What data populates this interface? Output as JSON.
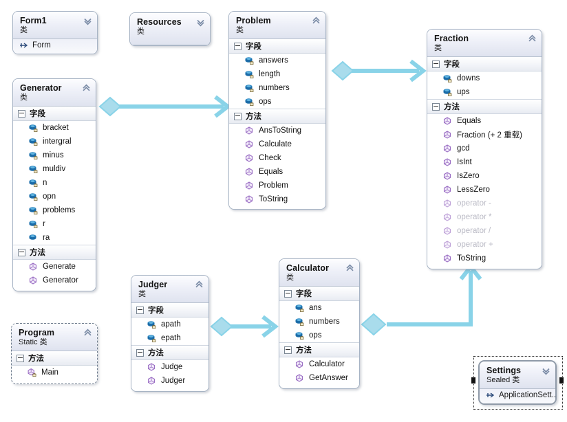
{
  "diagram": {
    "kind_class": "类",
    "kind_static_class": "Static 类",
    "kind_sealed_class": "Sealed 类",
    "compartment_fields": "字段",
    "compartment_methods": "方法",
    "colors": {
      "connector": "#89d3e8",
      "connector_fill": "#a9dcec",
      "class_border": "#a6b3c4",
      "header_gradient_top": "#fdfdff",
      "header_gradient_bottom": "#dfe3ef",
      "field_icon": "#1f6fa8",
      "method_icon": "#9b6fc4",
      "dimmed_text": "#b9b9c4"
    }
  },
  "classes": {
    "form1": {
      "name": "Form1",
      "kind": "类",
      "chevron": "chevron-down-icon",
      "base": "Form",
      "base_icon": "inherit-arrow-icon"
    },
    "resources": {
      "name": "Resources",
      "kind": "类",
      "chevron": "chevron-down-icon"
    },
    "problem": {
      "name": "Problem",
      "kind": "类",
      "chevron": "chevron-up-icon",
      "fields_header": "字段",
      "fields": [
        {
          "name": "answers",
          "icon": "field-private-icon",
          "dim": false
        },
        {
          "name": "length",
          "icon": "field-private-icon",
          "dim": false
        },
        {
          "name": "numbers",
          "icon": "field-private-icon",
          "dim": false
        },
        {
          "name": "ops",
          "icon": "field-private-icon",
          "dim": false
        }
      ],
      "methods_header": "方法",
      "methods": [
        {
          "name": "AnsToString",
          "icon": "method-icon",
          "dim": false
        },
        {
          "name": "Calculate",
          "icon": "method-icon",
          "dim": false
        },
        {
          "name": "Check",
          "icon": "method-icon",
          "dim": false
        },
        {
          "name": "Equals",
          "icon": "method-icon",
          "dim": false
        },
        {
          "name": "Problem",
          "icon": "method-icon",
          "dim": false
        },
        {
          "name": "ToString",
          "icon": "method-icon",
          "dim": false
        }
      ]
    },
    "fraction": {
      "name": "Fraction",
      "kind": "类",
      "chevron": "chevron-up-icon",
      "fields_header": "字段",
      "fields": [
        {
          "name": "downs",
          "icon": "field-private-icon",
          "dim": false
        },
        {
          "name": "ups",
          "icon": "field-private-icon",
          "dim": false
        }
      ],
      "methods_header": "方法",
      "methods": [
        {
          "name": "Equals",
          "icon": "method-icon",
          "dim": false
        },
        {
          "name": "Fraction (+ 2 重载)",
          "icon": "method-icon",
          "dim": false
        },
        {
          "name": "gcd",
          "icon": "method-icon",
          "dim": false
        },
        {
          "name": "IsInt",
          "icon": "method-icon",
          "dim": false
        },
        {
          "name": "IsZero",
          "icon": "method-icon",
          "dim": false
        },
        {
          "name": "LessZero",
          "icon": "method-icon",
          "dim": false
        },
        {
          "name": "operator -",
          "icon": "method-icon",
          "dim": true
        },
        {
          "name": "operator *",
          "icon": "method-icon",
          "dim": true
        },
        {
          "name": "operator /",
          "icon": "method-icon",
          "dim": true
        },
        {
          "name": "operator +",
          "icon": "method-icon",
          "dim": true
        },
        {
          "name": "ToString",
          "icon": "method-icon",
          "dim": false
        }
      ]
    },
    "generator": {
      "name": "Generator",
      "kind": "类",
      "chevron": "chevron-up-icon",
      "fields_header": "字段",
      "fields": [
        {
          "name": "bracket",
          "icon": "field-private-icon",
          "dim": false
        },
        {
          "name": "intergral",
          "icon": "field-private-icon",
          "dim": false
        },
        {
          "name": "minus",
          "icon": "field-private-icon",
          "dim": false
        },
        {
          "name": "muldiv",
          "icon": "field-private-icon",
          "dim": false
        },
        {
          "name": "n",
          "icon": "field-private-icon",
          "dim": false
        },
        {
          "name": "opn",
          "icon": "field-private-icon",
          "dim": false
        },
        {
          "name": "problems",
          "icon": "field-private-icon",
          "dim": false
        },
        {
          "name": "r",
          "icon": "field-private-icon",
          "dim": false
        },
        {
          "name": "ra",
          "icon": "field-public-icon",
          "dim": false
        }
      ],
      "methods_header": "方法",
      "methods": [
        {
          "name": "Generate",
          "icon": "method-icon",
          "dim": false
        },
        {
          "name": "Generator",
          "icon": "method-icon",
          "dim": false
        }
      ]
    },
    "program": {
      "name": "Program",
      "kind": "Static 类",
      "chevron": "chevron-up-icon",
      "methods_header": "方法",
      "methods": [
        {
          "name": "Main",
          "icon": "method-private-icon",
          "dim": false
        }
      ]
    },
    "judger": {
      "name": "Judger",
      "kind": "类",
      "chevron": "chevron-up-icon",
      "fields_header": "字段",
      "fields": [
        {
          "name": "apath",
          "icon": "field-private-icon",
          "dim": false
        },
        {
          "name": "epath",
          "icon": "field-private-icon",
          "dim": false
        }
      ],
      "methods_header": "方法",
      "methods": [
        {
          "name": "Judge",
          "icon": "method-icon",
          "dim": false
        },
        {
          "name": "Judger",
          "icon": "method-icon",
          "dim": false
        }
      ]
    },
    "calculator": {
      "name": "Calculator",
      "kind": "类",
      "chevron": "chevron-up-icon",
      "fields_header": "字段",
      "fields": [
        {
          "name": "ans",
          "icon": "field-private-icon",
          "dim": false
        },
        {
          "name": "numbers",
          "icon": "field-private-icon",
          "dim": false
        },
        {
          "name": "ops",
          "icon": "field-private-icon",
          "dim": false
        }
      ],
      "methods_header": "方法",
      "methods": [
        {
          "name": "Calculator",
          "icon": "method-icon",
          "dim": false
        },
        {
          "name": "GetAnswer",
          "icon": "method-icon",
          "dim": false
        }
      ]
    },
    "settings": {
      "name": "Settings",
      "kind": "Sealed 类",
      "chevron": "chevron-down-icon",
      "base": "ApplicationSett...",
      "base_icon": "inherit-arrow-icon",
      "selected": true
    }
  },
  "connectors": [
    {
      "name": "generator-to-problem",
      "from": "Generator",
      "to": "Problem",
      "style": "association"
    },
    {
      "name": "problem-to-fraction",
      "from": "Problem",
      "to": "Fraction",
      "style": "association"
    },
    {
      "name": "judger-to-calculator",
      "from": "Judger",
      "to": "Calculator",
      "style": "association"
    },
    {
      "name": "calculator-to-fraction",
      "from": "Calculator",
      "to": "Fraction",
      "style": "association"
    }
  ]
}
